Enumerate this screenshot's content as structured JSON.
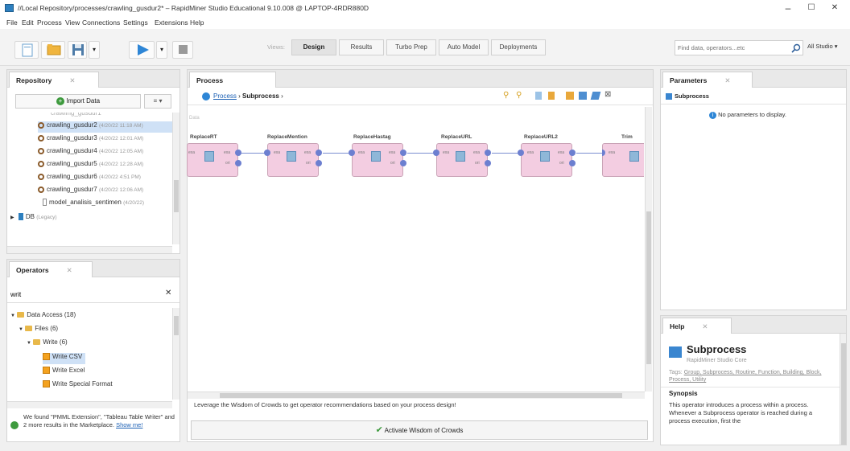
{
  "window": {
    "title": "//Local Repository/processes/crawling_gusdur2* – RapidMiner Studio Educational 9.10.008 @ LAPTOP-4RDR880D",
    "controls": [
      "–",
      "☐",
      "✕"
    ]
  },
  "menu": [
    "File",
    "Edit",
    "Process",
    "View",
    "Connections",
    "Settings",
    "Extensions",
    "Help"
  ],
  "toolbar": {
    "views_label": "Views:",
    "views": [
      "Design",
      "Results",
      "Turbo Prep",
      "Auto Model",
      "Deployments"
    ],
    "active_view": "Design",
    "search_placeholder": "Find data, operators...etc",
    "studio_label": "All Studio ▾"
  },
  "repository": {
    "tab_label": "Repository",
    "import_label": "Import Data",
    "menu_label": "≡ ▾",
    "items": [
      {
        "name": "crawling_gusdur2",
        "meta": "(4/20/22 11:18 AM)",
        "selected": true
      },
      {
        "name": "crawling_gusdur3",
        "meta": "(4/20/22 12:01 AM)"
      },
      {
        "name": "crawling_gusdur4",
        "meta": "(4/20/22 12:05 AM)"
      },
      {
        "name": "crawling_gusdur5",
        "meta": "(4/20/22 12:28 AM)"
      },
      {
        "name": "crawling_gusdur6",
        "meta": "(4/20/22 4:51 PM)"
      },
      {
        "name": "crawling_gusdur7",
        "meta": "(4/20/22 12:06 AM)"
      },
      {
        "name": "model_analisis_sentimen",
        "meta": "(4/20/22)"
      }
    ],
    "db_label": "DB",
    "db_meta": "(Legacy)"
  },
  "operators": {
    "tab_label": "Operators",
    "search_value": "writ",
    "tree": [
      {
        "label": "Data Access (18)",
        "level": 0,
        "type": "folder"
      },
      {
        "label": "Files (6)",
        "level": 1,
        "type": "folder"
      },
      {
        "label": "Write (6)",
        "level": 2,
        "type": "folder"
      },
      {
        "label": "Write CSV",
        "level": 3,
        "type": "op",
        "selected": true
      },
      {
        "label": "Write Excel",
        "level": 3,
        "type": "op"
      },
      {
        "label": "Write Special Format",
        "level": 3,
        "type": "op"
      }
    ],
    "marketplace_text": "We found \"PMML Extension\", \"Tableau Table Writer\" and 2 more results in the Marketplace.",
    "show_me": "Show me!"
  },
  "process": {
    "tab_label": "Process",
    "breadcrumb_root": "Process",
    "breadcrumb_sep": "›",
    "breadcrumb_current": "Subprocess",
    "breadcrumb_end": "›",
    "canvas_label": "Data",
    "operator_labels": [
      "ReplaceRT",
      "ReplaceMention",
      "ReplaceHastag",
      "ReplaceURL",
      "ReplaceURL2",
      "Trim"
    ],
    "port_in": "exa",
    "port_out": "exa",
    "port_ori": "ori",
    "wisdom_text": "Leverage the Wisdom of Crowds to get operator recommendations based on your process design!",
    "activate_label": "Activate Wisdom of Crowds"
  },
  "parameters": {
    "tab_label": "Parameters",
    "operator": "Subprocess",
    "no_params": "No parameters to display."
  },
  "help": {
    "tab_label": "Help",
    "title": "Subprocess",
    "subtitle": "RapidMiner Studio Core",
    "tags_label": "Tags:",
    "tags": "Group, Subprocess, Routine, Function, Building, Block, Process, Utility",
    "synopsis_label": "Synopsis",
    "synopsis": "This operator introduces a process within a process. Whenever a Subprocess operator is reached during a process execution, first the"
  },
  "colors": {
    "operator_fill": "#f3cde1",
    "port": "#6c7fd0",
    "accent": "#1a5fb4",
    "run_button": "#2e86d6"
  }
}
